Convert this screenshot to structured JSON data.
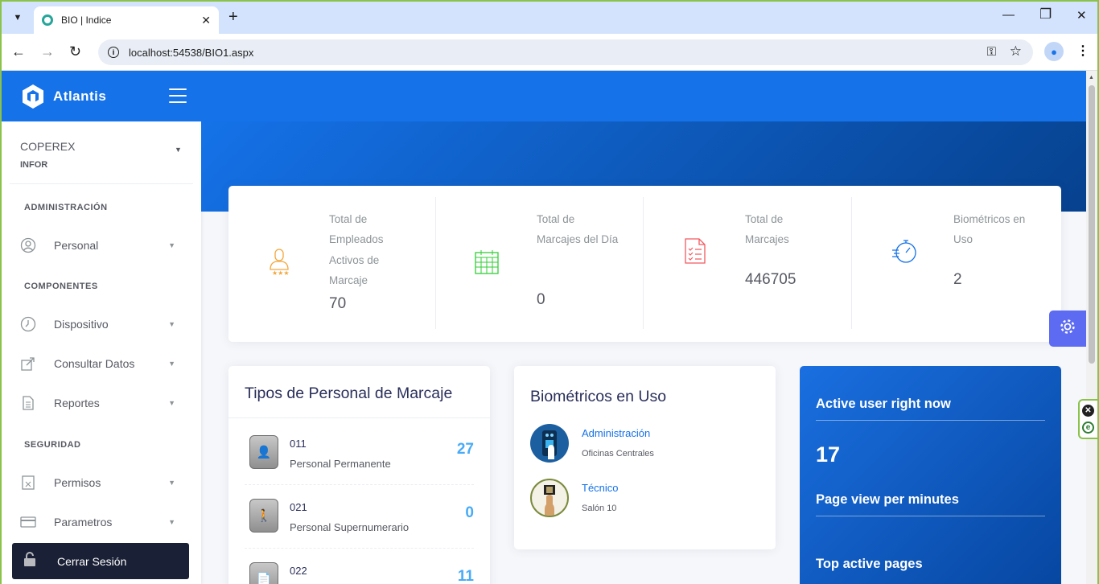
{
  "browser": {
    "tab_title": "BIO | Indice",
    "url": "localhost:54538/BIO1.aspx"
  },
  "brand": {
    "name": "Atlantis"
  },
  "user": {
    "name": "COPEREX",
    "role": "INFOR"
  },
  "sidebar": {
    "sections": [
      {
        "title": "ADMINISTRACIÓN",
        "items": [
          {
            "label": "Personal",
            "icon": "user-circle-icon"
          }
        ]
      },
      {
        "title": "COMPONENTES",
        "items": [
          {
            "label": "Dispositivo",
            "icon": "clock-icon"
          },
          {
            "label": "Consultar Datos",
            "icon": "share-icon"
          },
          {
            "label": "Reportes",
            "icon": "document-icon"
          }
        ]
      },
      {
        "title": "SEGURIDAD",
        "items": [
          {
            "label": "Permisos",
            "icon": "permissions-icon"
          },
          {
            "label": "Parametros",
            "icon": "card-icon"
          }
        ]
      }
    ],
    "logout_label": "Cerrar Sesión"
  },
  "stats": [
    {
      "label_lines": [
        "Total de",
        "Empleados",
        "Activos de",
        "Marcaje"
      ],
      "value": "70",
      "icon": "employee-icon",
      "color": "#f3a63b"
    },
    {
      "label_lines": [
        "Total de",
        "Marcajes del Día"
      ],
      "value": "0",
      "icon": "calendar-icon",
      "color": "#31ce36"
    },
    {
      "label_lines": [
        "Total de",
        "Marcajes"
      ],
      "value": "446705",
      "icon": "checklist-icon",
      "color": "#f25961"
    },
    {
      "label_lines": [
        "Biométricos en",
        "Uso"
      ],
      "value": "2",
      "icon": "stopwatch-icon",
      "color": "#1572e8"
    }
  ],
  "personal_types": {
    "title": "Tipos de Personal de Marcaje",
    "rows": [
      {
        "code": "011",
        "name": "Personal Permanente",
        "count": "27",
        "icon": "person-badge-icon"
      },
      {
        "code": "021",
        "name": "Personal Supernumerario",
        "count": "0",
        "icon": "walking-badge-icon"
      },
      {
        "code": "022",
        "name": "",
        "count": "11",
        "icon": "document-badge-icon"
      }
    ]
  },
  "biometrics": {
    "title": "Biométricos en Uso",
    "rows": [
      {
        "name": "Administración",
        "location": "Oficinas Centrales",
        "icon": "fingerprint-device-icon"
      },
      {
        "name": "Técnico",
        "location": "Salón 10",
        "icon": "finger-scan-icon"
      }
    ]
  },
  "active_panel": {
    "active_label": "Active user right now",
    "active_value": "17",
    "pageview_label": "Page view per minutes",
    "top_pages_label": "Top active pages"
  },
  "colors": {
    "primary": "#1572e8",
    "sidebar_dark": "#1a2035",
    "settings": "#5c6bf2",
    "count": "#48abf7"
  }
}
